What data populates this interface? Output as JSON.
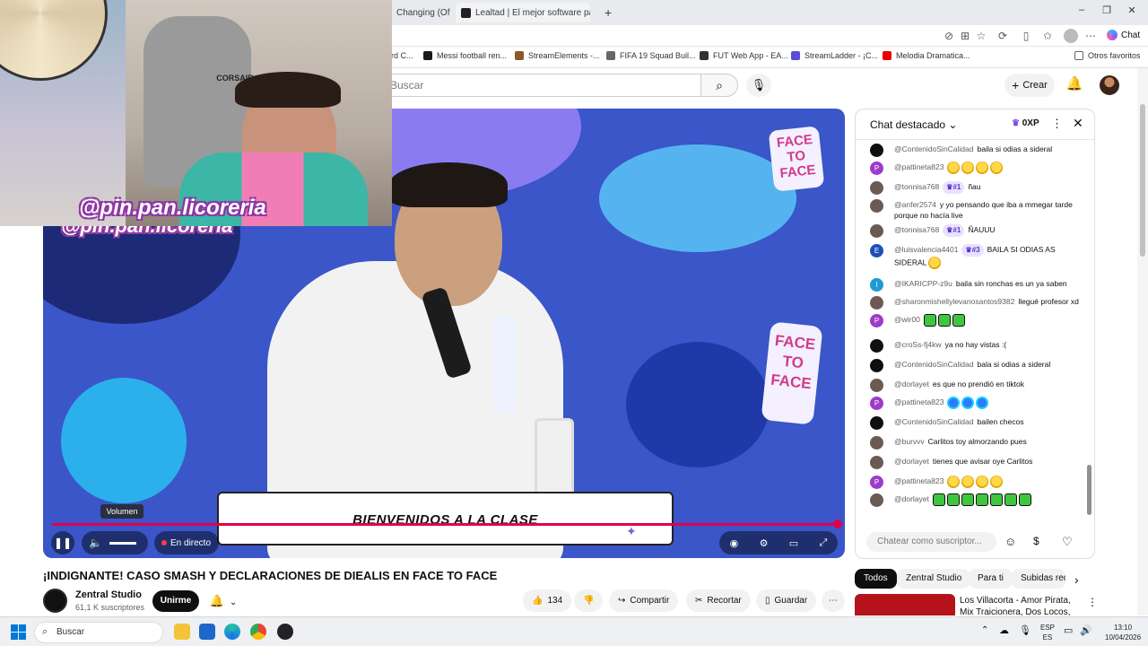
{
  "browser": {
    "tabs": [
      {
        "label": "Changing (Of"
      },
      {
        "label": "Lealtad | El mejor software para po"
      }
    ],
    "new_tab": "+",
    "chat_label": "Chat"
  },
  "bookmarks": [
    "rd C...",
    "Messi football ren...",
    "StreamElements -...",
    "FIFA 19 Squad Buil...",
    "FUT Web App - EA...",
    "StreamLadder - ¡C...",
    "Melodia Dramatica...",
    "Otros favoritos"
  ],
  "youtube": {
    "search_placeholder": "Buscar",
    "create_label": "Crear"
  },
  "overlay": {
    "handle": "@pin.pan.licoreria",
    "lower_third": "BIENVENIDOS A LA CLASE",
    "volume_tooltip": "Volumen",
    "live_label": "En directo",
    "face_logo": "FACE TO FACE"
  },
  "video": {
    "title": "¡INDIGNANTE! CASO SMASH Y DECLARACIONES DE DIEALIS EN FACE TO FACE",
    "channel": "Zentral Studio",
    "subscribers": "61,1 K suscriptores",
    "join_label": "Unirme",
    "likes": "134",
    "share_label": "Compartir",
    "clip_label": "Recortar",
    "save_label": "Guardar"
  },
  "chat": {
    "title": "Chat destacado",
    "points": "0XP",
    "input_placeholder": "Chatear como suscriptor...",
    "messages": [
      {
        "user": "@ContenidoSinCalidad",
        "badge": "",
        "text": "baila si odias a sideral",
        "av": "black",
        "emoji": "",
        "n": 0
      },
      {
        "user": "@pattineta823",
        "badge": "",
        "text": "",
        "av": "purple",
        "emoji": "y",
        "n": 4
      },
      {
        "user": "@tonnisa768",
        "badge": "#1",
        "text": "ñau",
        "av": "photo",
        "emoji": "",
        "n": 0
      },
      {
        "user": "@anfer2574",
        "badge": "",
        "text": "y yo pensando que iba a mmegar tarde porque no hacía live",
        "av": "photo",
        "emoji": "",
        "n": 0
      },
      {
        "user": "@tonnisa768",
        "badge": "#1",
        "text": "ÑAUUU",
        "av": "photo",
        "emoji": "",
        "n": 0
      },
      {
        "user": "@luisvalencia4401",
        "badge": "#3",
        "text": "BAILA SI ODIAS AS SIDERAL",
        "av": "blue",
        "emoji": "y",
        "n": 1
      },
      {
        "user": "@IKARICPP-z9u",
        "badge": "",
        "text": "baila sin ronchas es un ya saben",
        "av": "cyan",
        "emoji": "",
        "n": 0
      },
      {
        "user": "@sharonmishellylevanosantos9382",
        "badge": "",
        "text": "llegué profesor xd",
        "av": "photo",
        "emoji": "",
        "n": 0
      },
      {
        "user": "@wir00",
        "badge": "",
        "text": "",
        "av": "purple",
        "emoji": "g",
        "n": 3
      },
      {
        "user": "@croSs-fj4kw",
        "badge": "",
        "text": "ya no hay vistas :(",
        "av": "black",
        "emoji": "",
        "n": 0
      },
      {
        "user": "@ContenidoSinCalidad",
        "badge": "",
        "text": "bala si odias a sideral",
        "av": "black",
        "emoji": "",
        "n": 0
      },
      {
        "user": "@dorlayet",
        "badge": "",
        "text": "es que no prendió en tiktok",
        "av": "photo",
        "emoji": "",
        "n": 0
      },
      {
        "user": "@pattineta823",
        "badge": "",
        "text": "",
        "av": "purple",
        "emoji": "b",
        "n": 3
      },
      {
        "user": "@ContenidoSinCalidad",
        "badge": "",
        "text": "bailen checos",
        "av": "black",
        "emoji": "",
        "n": 0
      },
      {
        "user": "@burvvv",
        "badge": "",
        "text": "Carlitos toy almorzando pues",
        "av": "photo",
        "emoji": "",
        "n": 0
      },
      {
        "user": "@dorlayet",
        "badge": "",
        "text": "tienes que avisar oye Carlitos",
        "av": "photo",
        "emoji": "",
        "n": 0
      },
      {
        "user": "@pattineta823",
        "badge": "",
        "text": "",
        "av": "purple",
        "emoji": "y",
        "n": 4
      },
      {
        "user": "@dorlayet",
        "badge": "",
        "text": "",
        "av": "photo",
        "emoji": "g",
        "n": 7
      }
    ]
  },
  "recommend": {
    "chips": [
      "Todos",
      "Zentral Studio",
      "Para ti",
      "Subidas rec"
    ],
    "first_title": "Los Villacorta - Amor Pirata, Mix Traicionera, Dos Locos, N..."
  },
  "taskbar": {
    "search": "Buscar",
    "lang_top": "ESP",
    "lang_bottom": "ES",
    "time": "13:10",
    "date": "10/04/2026"
  }
}
